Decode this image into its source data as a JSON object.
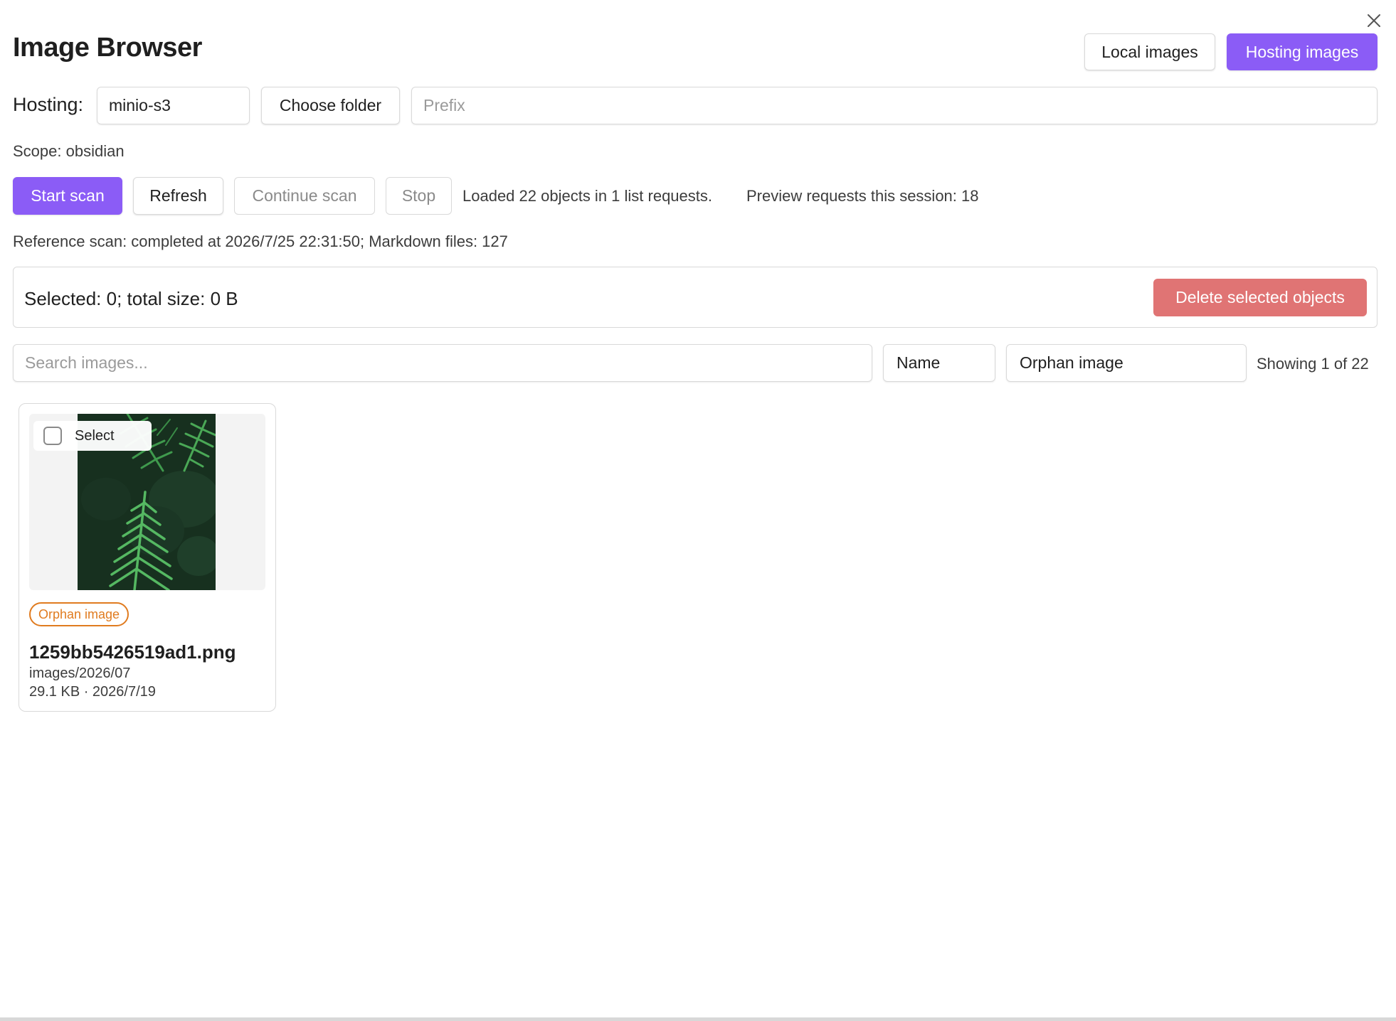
{
  "header": {
    "title": "Image Browser",
    "local_images_label": "Local images",
    "hosting_images_label": "Hosting images"
  },
  "hosting": {
    "label": "Hosting:",
    "value": "minio-s3",
    "choose_folder_label": "Choose folder",
    "prefix_placeholder": "Prefix",
    "prefix_value": ""
  },
  "scope": {
    "text": "Scope: obsidian"
  },
  "scan": {
    "start_label": "Start scan",
    "refresh_label": "Refresh",
    "continue_label": "Continue scan",
    "stop_label": "Stop",
    "loaded_text": "Loaded 22 objects in 1 list requests.",
    "preview_text": "Preview requests this session: 18",
    "reference_text": "Reference scan: completed at 2026/7/25 22:31:50; Markdown files: 127"
  },
  "selection": {
    "summary": "Selected: 0; total size: 0 B",
    "delete_label": "Delete selected objects"
  },
  "filters": {
    "search_placeholder": "Search images...",
    "search_value": "",
    "sort_value": "Name",
    "status_value": "Orphan image",
    "showing_text": "Showing 1 of 22"
  },
  "items": [
    {
      "select_label": "Select",
      "selected": false,
      "badge": "Orphan image",
      "filename": "1259bb5426519ad1.png",
      "path": "images/2026/07",
      "meta": "29.1 KB · 2026/7/19"
    }
  ],
  "colors": {
    "accent": "#8b5cf6",
    "danger": "#e07474",
    "orphan": "#e07b1f"
  }
}
